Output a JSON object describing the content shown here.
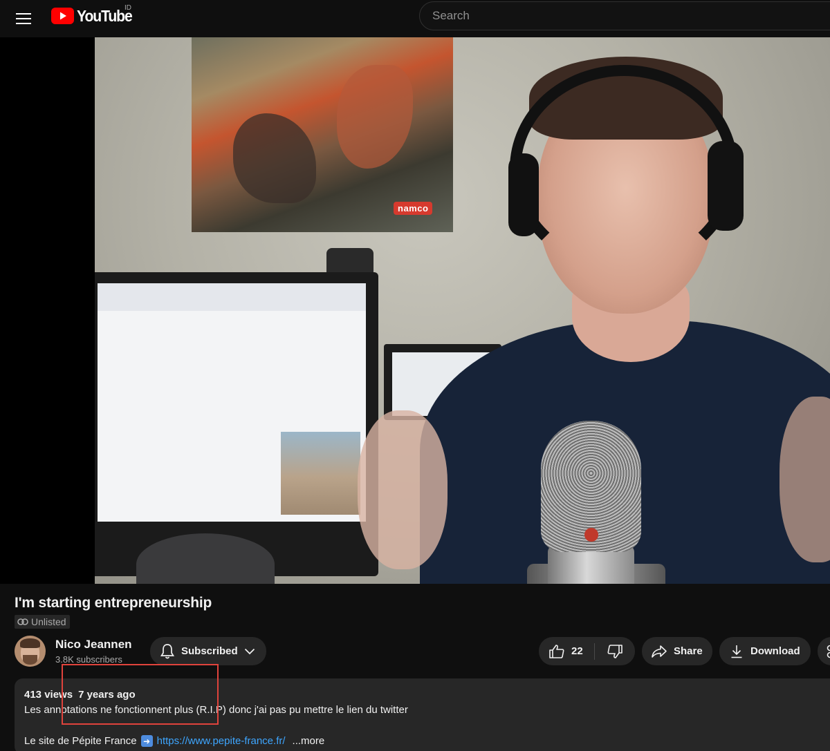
{
  "header": {
    "logo_text": "YouTube",
    "region": "ID",
    "search_placeholder": "Search"
  },
  "video": {
    "title": "I'm starting entrepreneurship",
    "visibility_badge": "Unlisted",
    "poster_text": "namco"
  },
  "channel": {
    "name": "Nico Jeannen",
    "subscribers": "3.8K subscribers"
  },
  "actions": {
    "subscribe_label": "Subscribed",
    "like_count": "22",
    "share_label": "Share",
    "download_label": "Download"
  },
  "description": {
    "views": "413 views",
    "date": "7 years ago",
    "line1": "Les annotations ne fonctionnent plus (R.I.P) donc j'ai pas pu mettre le lien du twitter",
    "line2_text": "Le site de Pépite France",
    "link": "https://www.pepite-france.fr/",
    "more": "...more"
  },
  "colors": {
    "background": "#0f0f0f",
    "button_bg": "#272727",
    "brand_red": "#ff0000",
    "link_blue": "#3ea6ff",
    "highlight_red": "#e0433c"
  }
}
